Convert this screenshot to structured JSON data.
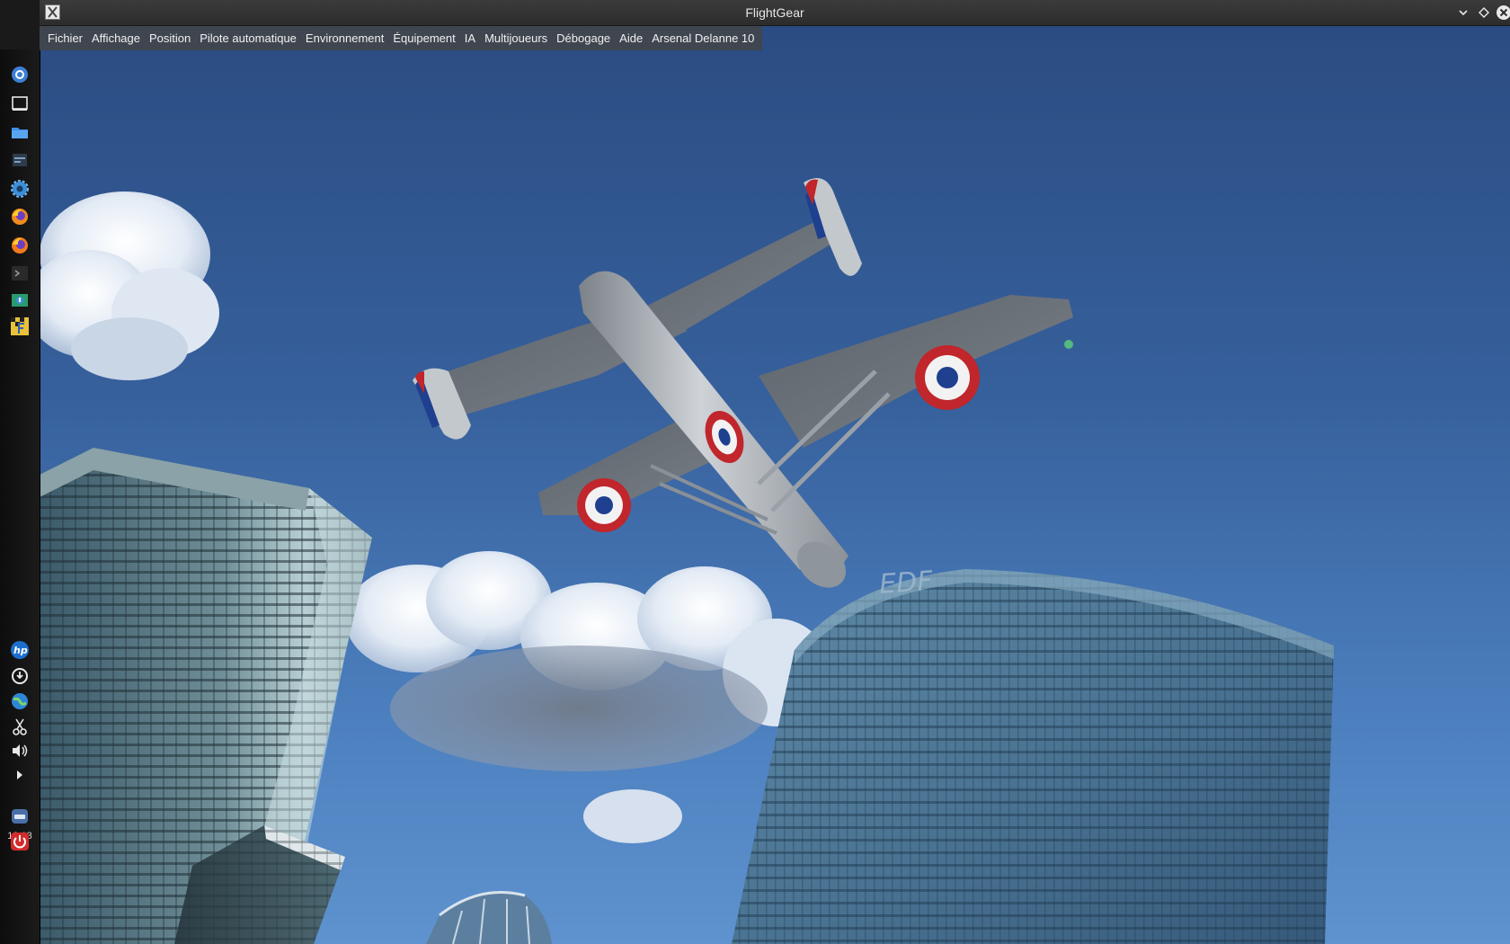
{
  "window": {
    "title": "FlightGear"
  },
  "menu": {
    "items": [
      {
        "id": "fichier",
        "label": "Fichier"
      },
      {
        "id": "affichage",
        "label": "Affichage"
      },
      {
        "id": "position",
        "label": "Position"
      },
      {
        "id": "pilote-automatique",
        "label": "Pilote automatique"
      },
      {
        "id": "environnement",
        "label": "Environnement"
      },
      {
        "id": "equipement",
        "label": "Équipement"
      },
      {
        "id": "ia",
        "label": "IA"
      },
      {
        "id": "multijoueurs",
        "label": "Multijoueurs"
      },
      {
        "id": "debogage",
        "label": "Débogage"
      },
      {
        "id": "aide",
        "label": "Aide"
      },
      {
        "id": "arsenal-delanne-10",
        "label": "Arsenal Delanne 10"
      }
    ]
  },
  "dock": {
    "clock": "19:13",
    "icons": [
      "app-menu-icon",
      "show-desktop-icon",
      "file-manager-icon",
      "settings-panel-icon",
      "system-settings-icon",
      "firefox-icon",
      "firefox-icon",
      "terminal-icon",
      "system-monitor-icon",
      "flightgear-icon",
      "hp-icon",
      "software-update-icon",
      "network-icon",
      "scissors-icon",
      "volume-icon",
      "expand-arrow-icon",
      "lock-screen-icon",
      "power-icon"
    ]
  },
  "scene": {
    "building_sign": "EDF",
    "colors": {
      "sky_top": "#2b4c82",
      "sky_bottom": "#5e93cf",
      "roundel_red": "#c0262b",
      "roundel_blue": "#1f3f8f",
      "aircraft_silver": "#a4aab2"
    }
  }
}
